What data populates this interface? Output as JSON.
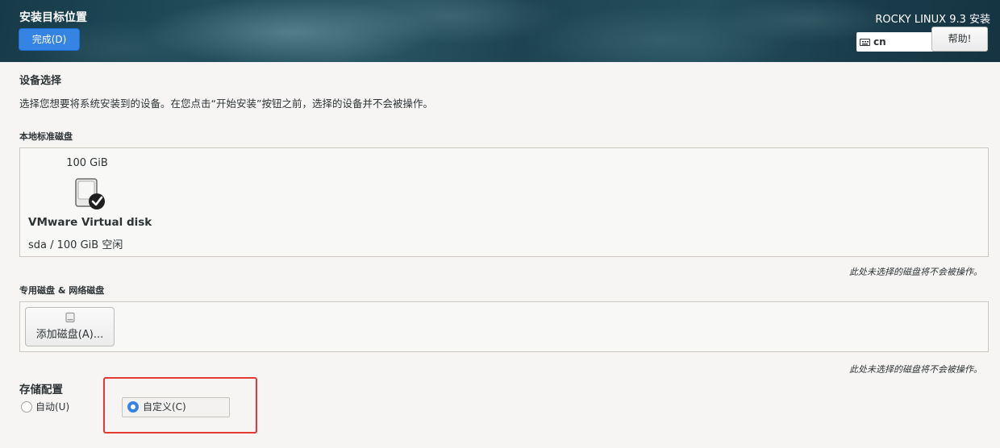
{
  "header": {
    "title": "安装目标位置",
    "done_button": "完成(D)",
    "product": "ROCKY LINUX 9.3 安装",
    "keyboard_layout": "cn",
    "keyboard_icon": "keyboard-icon",
    "help_button": "帮助!"
  },
  "device_selection": {
    "title": "设备选择",
    "description": "选择您想要将系统安装到的设备。在您点击“开始安装”按钮之前，选择的设备并不会被操作。"
  },
  "local_disks": {
    "label": "本地标准磁盘",
    "disks": [
      {
        "size": "100 GiB",
        "name": "VMware Virtual disk",
        "free": "sda  /  100 GiB 空闲",
        "selected": true,
        "icon": "hard-disk-checked-icon"
      }
    ],
    "note": "此处未选择的磁盘将不会被操作。"
  },
  "special_disks": {
    "label": "专用磁盘 & 网络磁盘",
    "add_button": "添加磁盘(A)...",
    "add_icon": "disk-icon",
    "note": "此处未选择的磁盘将不会被操作。"
  },
  "storage_config": {
    "title": "存储配置",
    "options": [
      {
        "label": "自动(U)",
        "selected": false
      },
      {
        "label": "自定义(C)",
        "selected": true
      }
    ]
  },
  "colors": {
    "accent": "#3584e4",
    "highlight": "#e33b32"
  }
}
